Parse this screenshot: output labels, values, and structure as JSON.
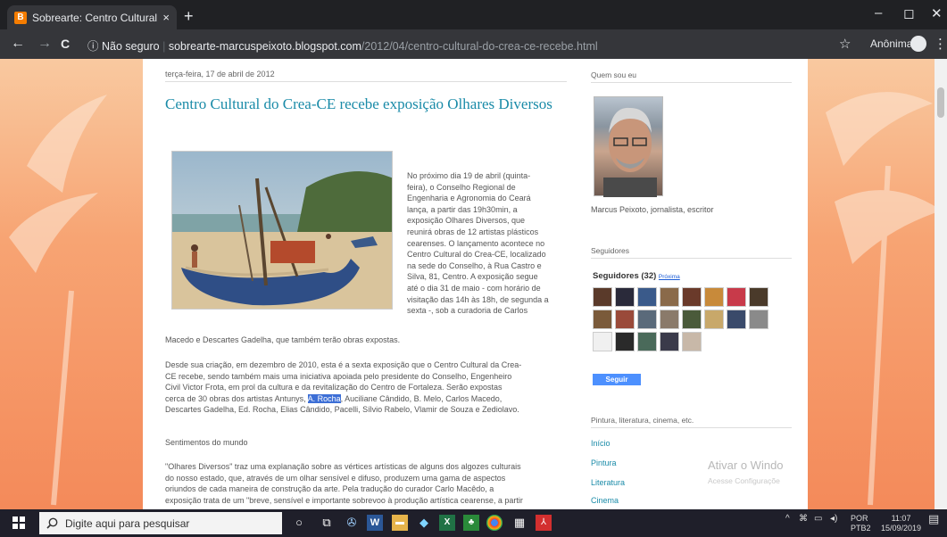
{
  "browser": {
    "tab_title": "Sobrearte: Centro Cultural do Cre",
    "tab_close": "×",
    "new_tab": "+",
    "security": "Não seguro",
    "url_host": "sobrearte-marcuspeixoto.blogspot.com",
    "url_path": "/2012/04/centro-cultural-do-crea-ce-recebe.html",
    "profile": "Anônima",
    "back": "←",
    "forward": "→",
    "reload": "C",
    "info": "ⓘ",
    "star": "☆",
    "kebab": "⋮",
    "minimize": "–",
    "maximize": "◻",
    "close": "✕"
  },
  "post": {
    "date": "terça-feira, 17 de abril de 2012",
    "title": "Centro Cultural do Crea-CE recebe exposição Olhares Diversos",
    "side_lines": [
      "No próximo dia 19 de abril (quinta-",
      "feira), o Conselho Regional de",
      "Engenharia e Agronomia do Ceará",
      "lança, a partir das 19h30min, a",
      "exposição Olhares Diversos, que",
      "reunirá obras de 12 artistas plásticos",
      "cearenses. O lançamento acontece no",
      "Centro Cultural do Crea-CE, localizado",
      "na sede do Conselho, à Rua Castro e",
      "Silva, 81, Centro. A exposição segue",
      "até o dia 31 de maio - com horário de",
      "visitação das 14h às 18h, de segunda a",
      "sexta -, sob a curadoria de Carlos"
    ],
    "continuation": "Macedo e Descartes Gadelha, que também terão obras expostas.",
    "para2_line1": "Desde sua criação, em dezembro de 2010, esta é a sexta exposição que o Centro Cultural da Crea-",
    "para2_line2": "CE recebe, sendo também mais uma iniciativa apoiada pelo presidente do Conselho, Engenheiro",
    "para2_line3": "Civil Victor Frota, em prol da cultura e da revitalização do Centro de Fortaleza. Serão expostas",
    "para2_line4_a": "cerca de 30 obras dos artistas Antunys, ",
    "para2_line4_hl": "A. Rocha",
    "para2_line4_b": ", Auciliane Cândido, B. Melo, Carlos Macedo,",
    "para2_line5": "Descartes Gadelha, Ed. Rocha, Elias Cândido, Pacelli, Sílvio Rabelo, Vlamir de Souza e Zediolavo.",
    "subheading": "Sentimentos do mundo",
    "para3_line1": "\"Olhares Diversos\" traz uma explanação sobre as vértices artísticas de alguns dos algozes culturais",
    "para3_line2": "do nosso estado, que, através de um olhar sensível e difuso, produzem uma gama de aspectos",
    "para3_line3": "oriundos de cada maneira de construção da arte. Pela tradução do curador Carlo Macêdo, a",
    "para3_line4": "exposição trata de um \"breve, sensível e importante sobrevoo à produção artística cearense, a partir"
  },
  "sidebar": {
    "about_heading": "Quem sou eu",
    "author": "Marcus Peixoto, jornalista, escritor",
    "followers_heading": "Seguidores",
    "followers_count": "Seguidores (32)",
    "followers_next": "Próxima",
    "follow_button": "Seguir",
    "labels_heading": "Pintura, literatura, cinema, etc.",
    "links": [
      "Início",
      "Pintura",
      "Literatura",
      "Cinema"
    ]
  },
  "watermark": {
    "line1": "Ativar o Windo",
    "line2": "Acesse Configuraçõe"
  },
  "taskbar": {
    "search_placeholder": "Digite aqui para pesquisar",
    "lang1": "POR",
    "lang2": "PTB2",
    "time": "11:07",
    "date": "15/09/2019"
  },
  "colors": {
    "link": "#1a8ba8",
    "highlight": "#3d6fd6",
    "page_bg": "#f7a070",
    "follow_button": "#4d90fe"
  }
}
